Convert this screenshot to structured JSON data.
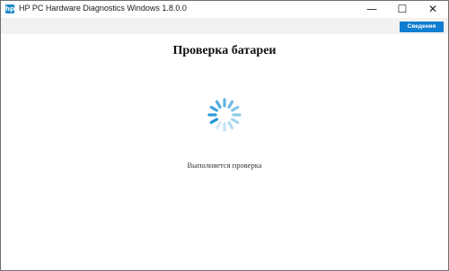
{
  "window": {
    "title": "HP PC Hardware Diagnostics Windows 1.8.0.0",
    "icon": "hp-app-icon",
    "controls": {
      "minimize": "—",
      "maximize": "☐",
      "close": "✕"
    }
  },
  "toolbar": {
    "info_label": "Сведения"
  },
  "main": {
    "heading": "Проверка батареи",
    "status": "Выполняется проверка",
    "spinner_icon": "loading-spinner-icon"
  },
  "colors": {
    "accent": "#0f7dd0",
    "spinner": "#1e93d6",
    "toolbar_bg": "#f2f2f2"
  }
}
